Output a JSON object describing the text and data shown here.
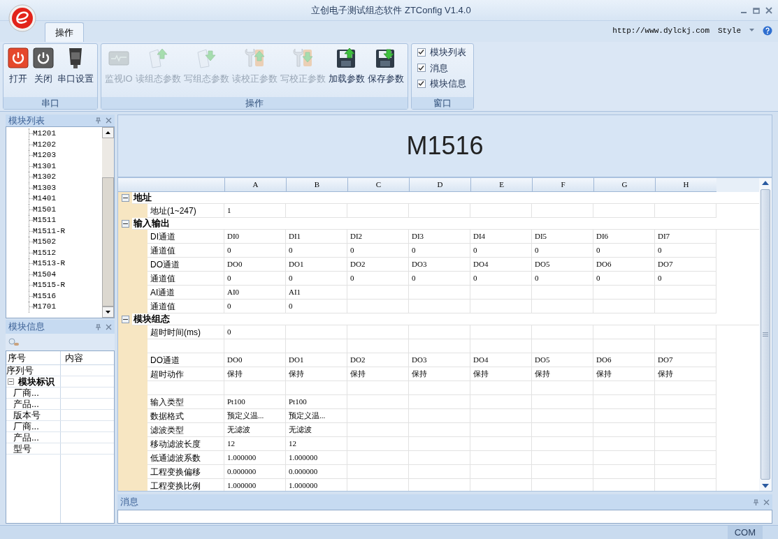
{
  "window": {
    "title": "立创电子测试组态软件 ZTConfig V1.4.0"
  },
  "tabs": [
    {
      "label": "操作",
      "selected": true
    }
  ],
  "header_link": "http://www.dylckj.com",
  "style_menu": "Style",
  "ribbon_groups": [
    {
      "label": "串口",
      "kind": "buttons",
      "buttons": [
        {
          "label": "打开",
          "disabled": false
        },
        {
          "label": "关闭",
          "disabled": false
        },
        {
          "label": "串口设置",
          "disabled": false
        }
      ]
    },
    {
      "label": "操作",
      "kind": "buttons",
      "buttons": [
        {
          "label": "监视IO",
          "disabled": true
        },
        {
          "label": "读组态参数",
          "disabled": true
        },
        {
          "label": "写组态参数",
          "disabled": true
        },
        {
          "label": "读校正参数",
          "disabled": true
        },
        {
          "label": "写校正参数",
          "disabled": true
        },
        {
          "label": "加载参数",
          "disabled": false
        },
        {
          "label": "保存参数",
          "disabled": false
        }
      ]
    },
    {
      "label": "窗口",
      "kind": "checks",
      "checks": [
        {
          "label": "模块列表",
          "checked": true
        },
        {
          "label": "消息",
          "checked": true
        },
        {
          "label": "模块信息",
          "checked": true
        }
      ]
    }
  ],
  "module_list": {
    "title": "模块列表",
    "items": [
      "M1201",
      "M1202",
      "M1203",
      "M1301",
      "M1302",
      "M1303",
      "M1401",
      "M1501",
      "M1511",
      "M1511-R",
      "M1502",
      "M1512",
      "M1513-R",
      "M1504",
      "M1515-R",
      "M1516",
      "M1701"
    ]
  },
  "module_info": {
    "title": "模块信息",
    "columns": [
      "序号",
      "内容"
    ],
    "rows": [
      {
        "label": "序列号"
      },
      {
        "label": "模块标识",
        "expanded": true,
        "children": [
          {
            "label": "厂商..."
          },
          {
            "label": "产品..."
          },
          {
            "label": "版本号"
          },
          {
            "label": "厂商..."
          },
          {
            "label": "产品..."
          },
          {
            "label": "型号"
          }
        ]
      }
    ]
  },
  "editor": {
    "module": "M1516",
    "columns": [
      "A",
      "B",
      "C",
      "D",
      "E",
      "F",
      "G",
      "H"
    ],
    "sections": [
      {
        "title": "地址",
        "expanded": true,
        "rows": [
          {
            "kind": "data",
            "label": "地址(1~247)",
            "cells": [
              "1"
            ]
          }
        ]
      },
      {
        "title": "输入输出",
        "expanded": true,
        "rows": [
          {
            "kind": "data",
            "label": "DI通道",
            "cells": [
              "DI0",
              "DI1",
              "DI2",
              "DI3",
              "DI4",
              "DI5",
              "DI6",
              "DI7"
            ]
          },
          {
            "kind": "data",
            "label": "通道值",
            "cells": [
              "0",
              "0",
              "0",
              "0",
              "0",
              "0",
              "0",
              "0"
            ]
          },
          {
            "kind": "data",
            "label": "DO通道",
            "cells": [
              "DO0",
              "DO1",
              "DO2",
              "DO3",
              "DO4",
              "DO5",
              "DO6",
              "DO7"
            ]
          },
          {
            "kind": "data",
            "label": "通道值",
            "cells": [
              "0",
              "0",
              "0",
              "0",
              "0",
              "0",
              "0",
              "0"
            ]
          },
          {
            "kind": "data",
            "label": "AI通道",
            "cells": [
              "AI0",
              "AI1"
            ]
          },
          {
            "kind": "data",
            "label": "通道值",
            "cells": [
              "0",
              "0"
            ]
          }
        ]
      },
      {
        "title": "模块组态",
        "expanded": true,
        "rows": [
          {
            "kind": "data",
            "label": "超时时间(ms)",
            "cells": [
              "0"
            ]
          },
          {
            "kind": "spacer"
          },
          {
            "kind": "data",
            "label": "DO通道",
            "cells": [
              "DO0",
              "DO1",
              "DO2",
              "DO3",
              "DO4",
              "DO5",
              "DO6",
              "DO7"
            ]
          },
          {
            "kind": "data",
            "label": "超时动作",
            "cells": [
              "保持",
              "保持",
              "保持",
              "保持",
              "保持",
              "保持",
              "保持",
              "保持"
            ]
          },
          {
            "kind": "spacer"
          },
          {
            "kind": "data",
            "label": "输入类型",
            "cells": [
              "Pt100",
              "Pt100"
            ]
          },
          {
            "kind": "data",
            "label": "数据格式",
            "cells": [
              "预定义温...",
              "预定义温..."
            ]
          },
          {
            "kind": "data",
            "label": "滤波类型",
            "cells": [
              "无滤波",
              "无滤波"
            ]
          },
          {
            "kind": "data",
            "label": "移动滤波长度",
            "cells": [
              "12",
              "12"
            ]
          },
          {
            "kind": "data",
            "label": "低通滤波系数",
            "cells": [
              "1.000000",
              "1.000000"
            ]
          },
          {
            "kind": "data",
            "label": "工程变换偏移",
            "cells": [
              "0.000000",
              "0.000000"
            ]
          },
          {
            "kind": "data",
            "label": "工程变换比例",
            "cells": [
              "1.000000",
              "1.000000"
            ]
          }
        ]
      }
    ]
  },
  "messages": {
    "title": "消息"
  },
  "status_bar": {
    "port": "COM"
  }
}
